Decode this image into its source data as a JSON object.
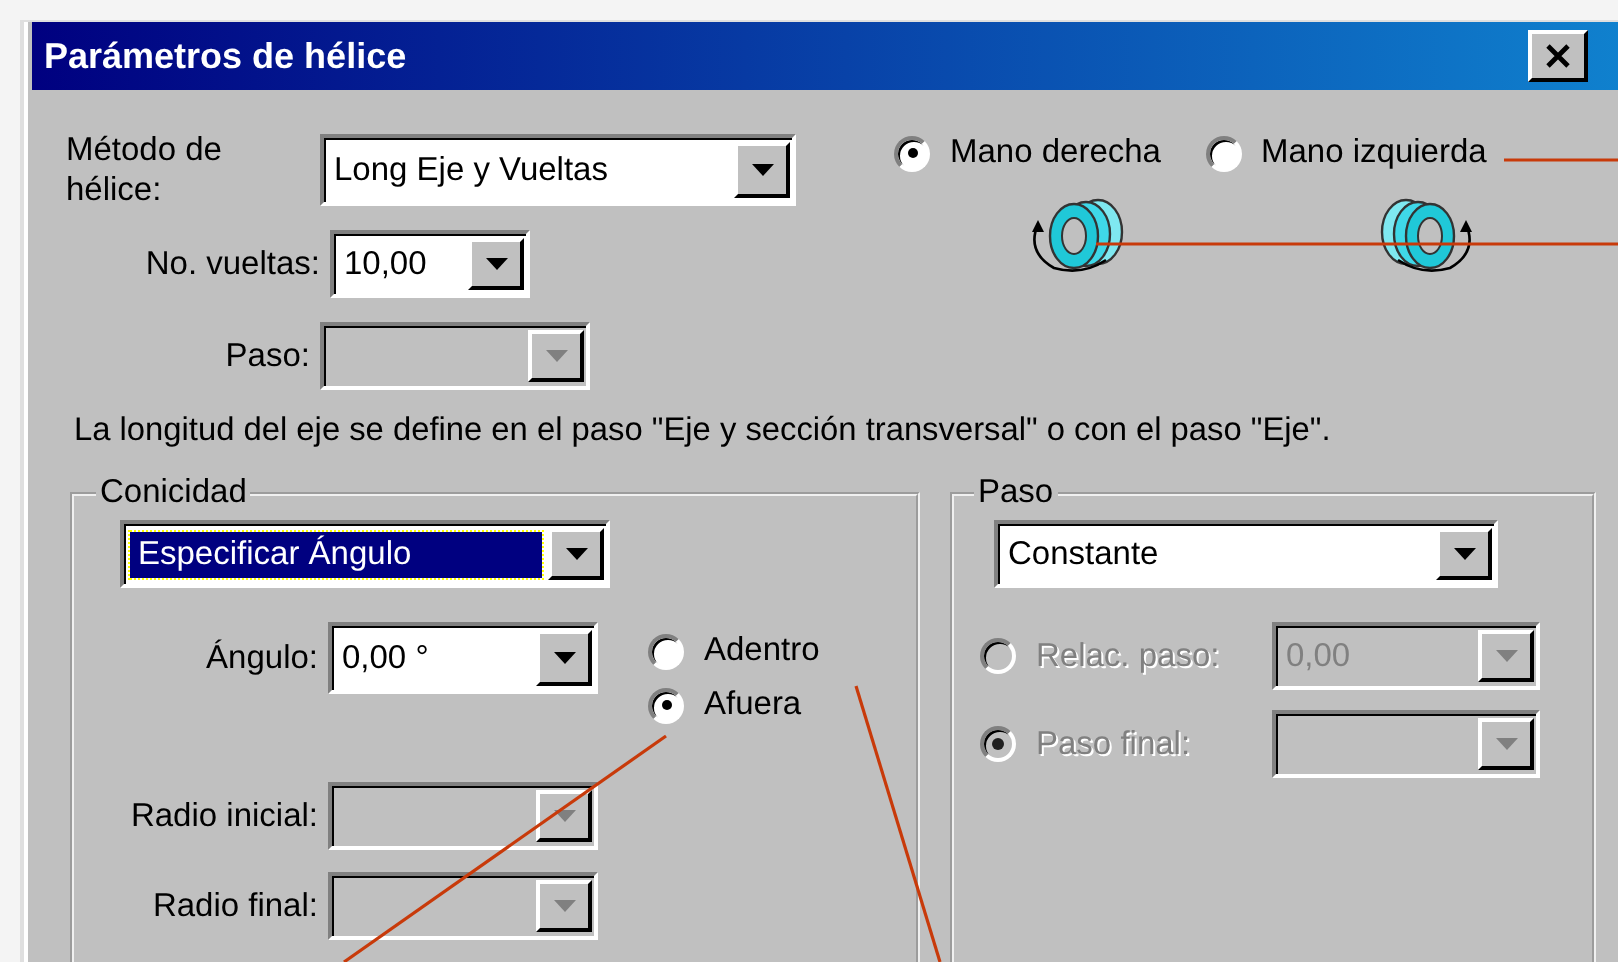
{
  "window": {
    "title": "Parámetros de hélice"
  },
  "method": {
    "label": "Método de hélice:",
    "value": "Long Eje y Vueltas",
    "disabled": false
  },
  "turns": {
    "label": "No. vueltas:",
    "value": "10,00",
    "disabled": false
  },
  "pitch_field": {
    "label": "Paso:",
    "disabled": true
  },
  "hand": [
    {
      "label": "Mano derecha",
      "selected": true
    },
    {
      "label": "Mano izquierda",
      "selected": false
    }
  ],
  "note": "La longitud del eje se define en el paso \"Eje y sección transversal\" o con el paso \"Eje\".",
  "taper": {
    "title": "Conicidad",
    "mode": {
      "value": "Especificar Ángulo",
      "focused": true
    },
    "angle": {
      "label": "Ángulo:",
      "value": "0,00 °",
      "disabled": false
    },
    "direction": [
      {
        "label": "Adentro",
        "selected": false
      },
      {
        "label": "Afuera",
        "selected": true
      }
    ],
    "start_radius": {
      "label": "Radio inicial:",
      "disabled": true
    },
    "end_radius": {
      "label": "Radio final:",
      "disabled": true
    }
  },
  "pitch": {
    "title": "Paso",
    "mode": {
      "value": "Constante",
      "focused": false
    },
    "options": [
      {
        "label": "Relac. paso:",
        "selected": false,
        "disabled": true,
        "value": "0,00"
      },
      {
        "label": "Paso final:",
        "selected": true,
        "disabled": true
      }
    ]
  }
}
